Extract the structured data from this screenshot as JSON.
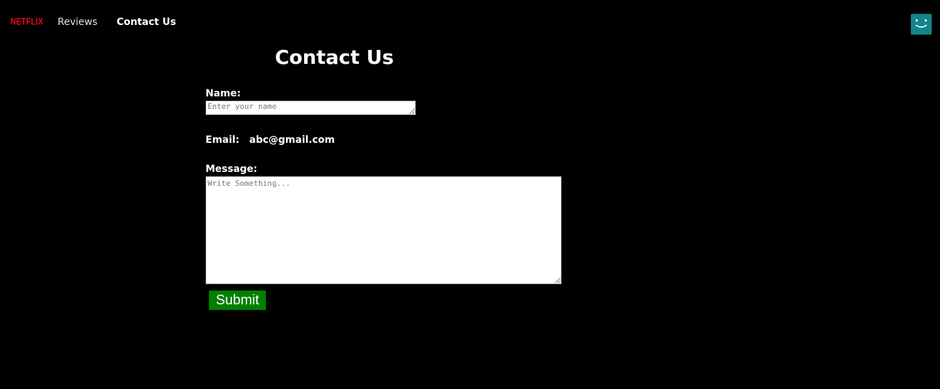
{
  "nav": {
    "logo_text": "NETFLIX",
    "links": [
      {
        "label": "Reviews",
        "active": false
      },
      {
        "label": "Contact Us",
        "active": true
      }
    ],
    "avatar_icon": "smiley-avatar-icon"
  },
  "form": {
    "title": "Contact Us",
    "name_label": "Name:",
    "name_placeholder": "Enter your name",
    "name_value": "",
    "email_label": "Email:",
    "email_value": "abc@gmail.com",
    "message_label": "Message:",
    "message_placeholder": "Write Something...",
    "message_value": "",
    "submit_label": "Submit"
  },
  "colors": {
    "background": "#000000",
    "text": "#ffffff",
    "logo": "#e50914",
    "avatar": "#12848a",
    "submit": "#008000"
  }
}
